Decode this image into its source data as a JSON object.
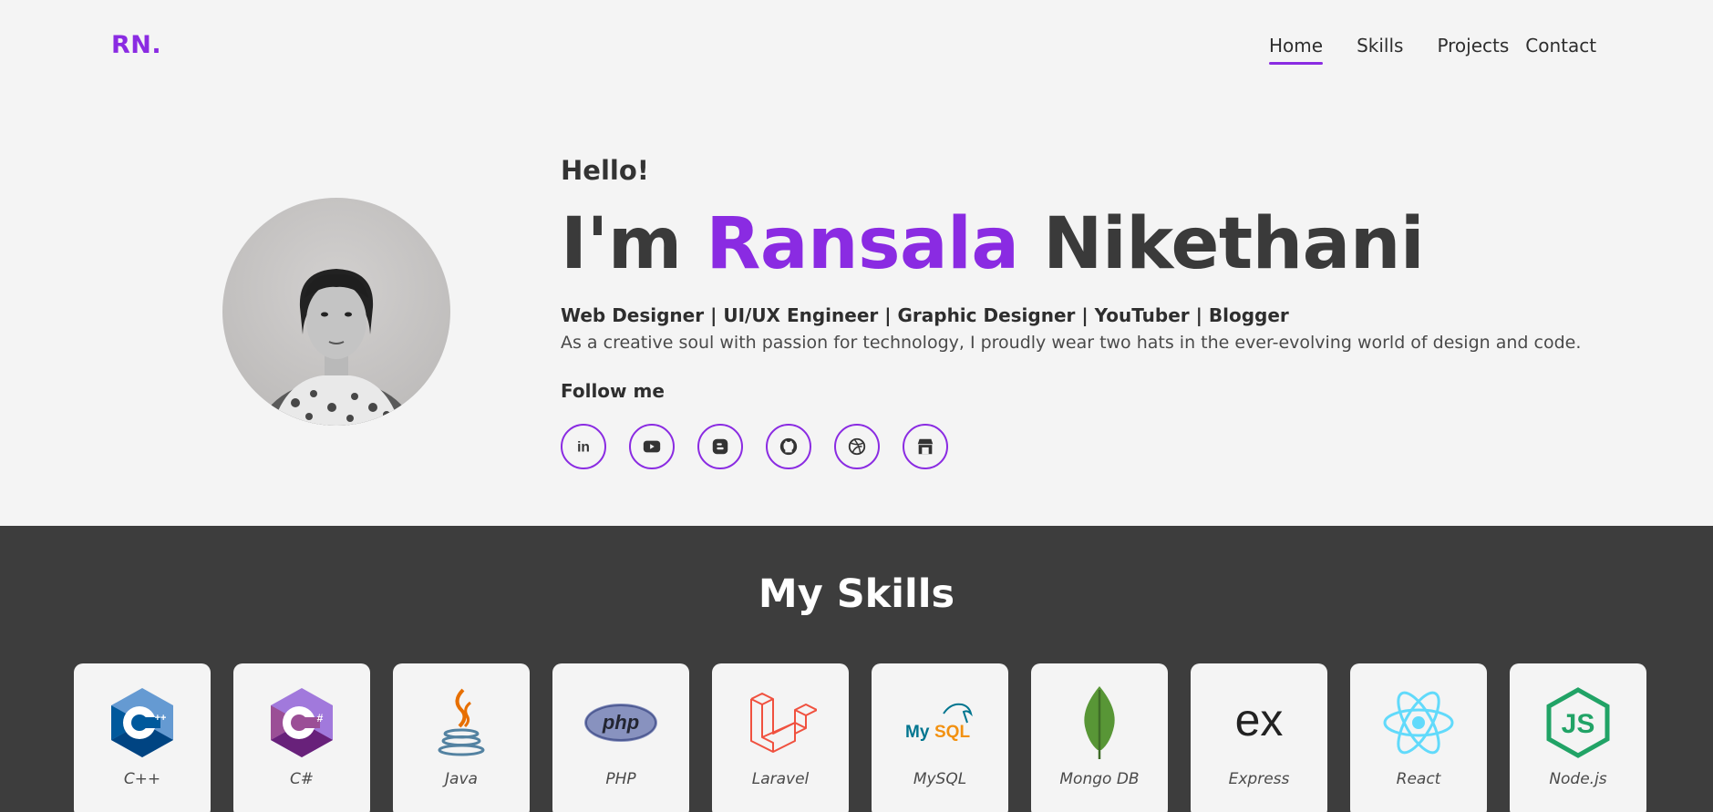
{
  "nav": {
    "logo": "RN.",
    "links": [
      {
        "label": "Home"
      },
      {
        "label": "Skills"
      },
      {
        "label": "Projects"
      },
      {
        "label": "Contact"
      }
    ],
    "accent_color": "#8a2be2"
  },
  "hero": {
    "greeting": "Hello!",
    "name_prefix": "I'm",
    "first_name": "Ransala",
    "last_name": "Nikethani",
    "roles": "Web Designer | UI/UX Engineer | Graphic Designer | YouTuber | Blogger",
    "description": "As a creative soul with passion for technology, I proudly wear two hats in the ever-evolving world of design and code.",
    "follow_label": "Follow me",
    "socials": [
      {
        "icon": "linkedin-icon"
      },
      {
        "icon": "youtube-icon"
      },
      {
        "icon": "blogger-icon"
      },
      {
        "icon": "github-icon"
      },
      {
        "icon": "dribbble-icon"
      },
      {
        "icon": "store-icon"
      }
    ]
  },
  "skills": {
    "title": "My Skills",
    "items": [
      {
        "label": "C++",
        "icon": "cpp-logo-icon"
      },
      {
        "label": "C#",
        "icon": "csharp-logo-icon"
      },
      {
        "label": "Java",
        "icon": "java-logo-icon"
      },
      {
        "label": "PHP",
        "icon": "php-logo-icon"
      },
      {
        "label": "Laravel",
        "icon": "laravel-logo-icon"
      },
      {
        "label": "MySQL",
        "icon": "mysql-logo-icon"
      },
      {
        "label": "Mongo DB",
        "icon": "mongodb-logo-icon"
      },
      {
        "label": "Express",
        "icon": "express-logo-icon"
      },
      {
        "label": "React",
        "icon": "react-logo-icon"
      },
      {
        "label": "Node.js",
        "icon": "nodejs-logo-icon"
      }
    ]
  }
}
